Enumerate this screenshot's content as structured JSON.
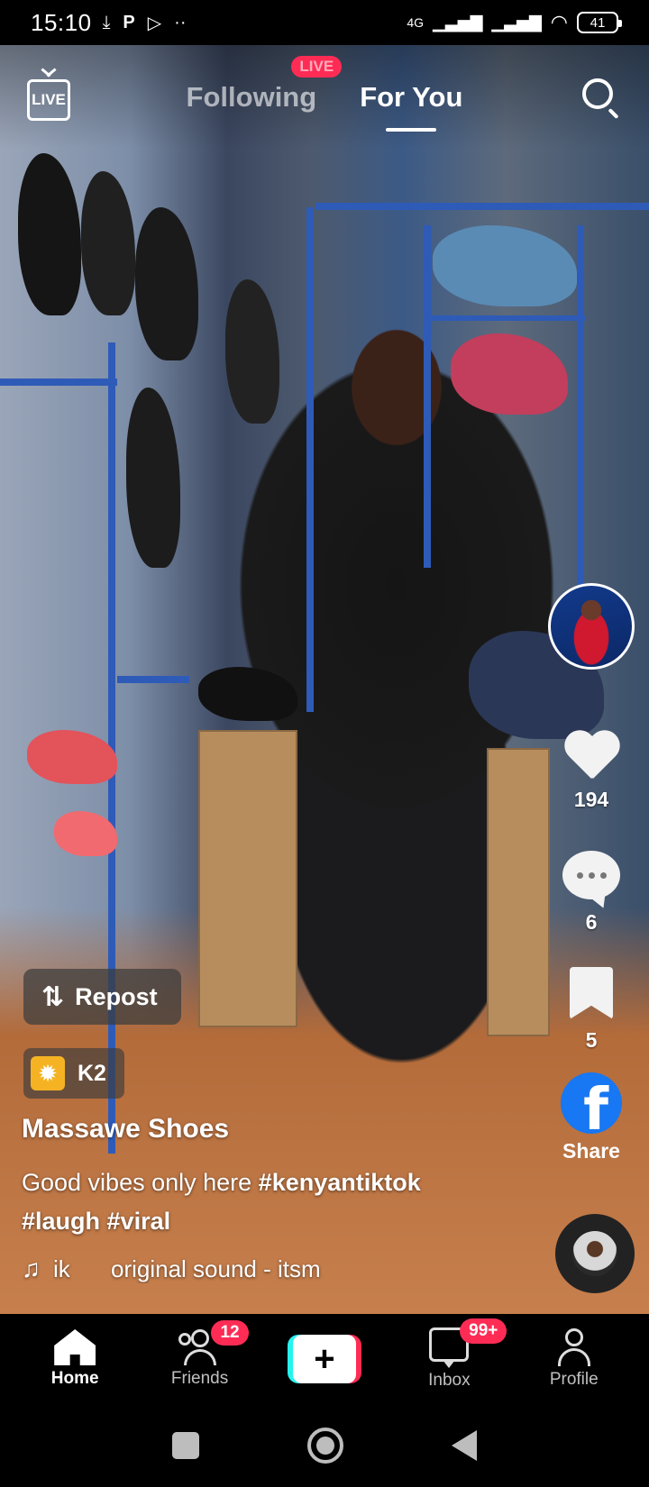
{
  "status_bar": {
    "time": "15:10",
    "left_icons": [
      "download-icon",
      "p-app-icon",
      "play-icon",
      "more-dots-icon"
    ],
    "network_label": "4G",
    "battery_level": "41"
  },
  "top_nav": {
    "live_label": "LIVE",
    "tabs": [
      {
        "label": "Following",
        "active": false,
        "badge": "LIVE"
      },
      {
        "label": "For You",
        "active": true
      }
    ]
  },
  "rail": {
    "likes": "194",
    "comments": "6",
    "saves": "5",
    "share_label": "Share",
    "share_icon": "f"
  },
  "post": {
    "repost_label": "Repost",
    "effect_label": "K2",
    "username": "Massawe Shoes",
    "caption_text": "Good vibes only here ",
    "hashtags": [
      "#kenyantiktok",
      "#laugh",
      "#viral"
    ],
    "music_author": "ik",
    "music_title": "original sound - itsm"
  },
  "bottom_nav": {
    "items": [
      {
        "label": "Home",
        "active": true
      },
      {
        "label": "Friends",
        "badge": "12"
      },
      {
        "label": "",
        "create": true,
        "symbol": "+"
      },
      {
        "label": "Inbox",
        "badge": "99+"
      },
      {
        "label": "Profile"
      }
    ]
  },
  "colors": {
    "accent": "#fe2c55",
    "cyan": "#25f4ee",
    "facebook": "#1877f2"
  }
}
